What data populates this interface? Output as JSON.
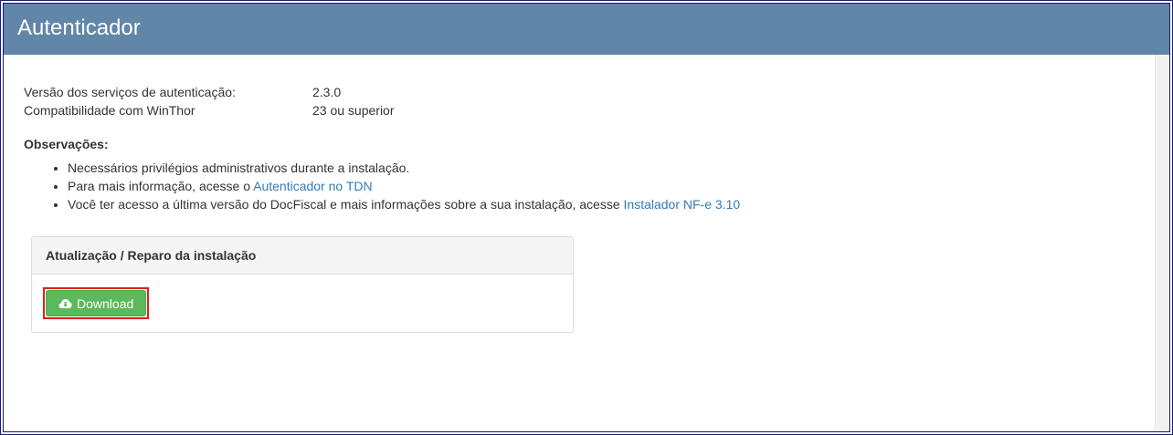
{
  "header": {
    "title": "Autenticador"
  },
  "info": [
    {
      "label": "Versão dos serviços de autenticação:",
      "value": "2.3.0"
    },
    {
      "label": "Compatibilidade com WinThor",
      "value": "23 ou superior"
    }
  ],
  "observations": {
    "title": "Observações:",
    "items": [
      {
        "text": "Necessários privilégios administrativos durante a instalação.",
        "link": ""
      },
      {
        "text": "Para mais informação, acesse o ",
        "link": "Autenticador no TDN"
      },
      {
        "text": "Você ter acesso a última versão do DocFiscal e mais informações sobre a sua instalação, acesse ",
        "link": "Instalador NF-e 3.10"
      }
    ]
  },
  "panel": {
    "title": "Atualização / Reparo da instalação",
    "button_label": "Download",
    "button_icon": "cloud-download-icon"
  },
  "colors": {
    "header_bg": "#6186a8",
    "link": "#337ab7",
    "button_bg": "#5cb85c",
    "highlight_border": "#e31d1d"
  }
}
